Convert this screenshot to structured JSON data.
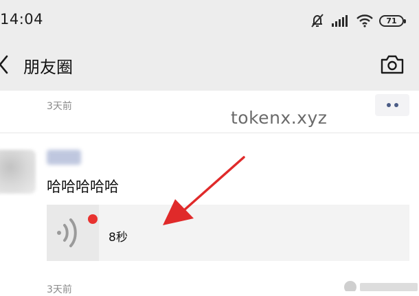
{
  "status_bar": {
    "time": "14:04",
    "battery": "71",
    "icons": [
      "mute-bell-icon",
      "signal-icon",
      "wifi-icon",
      "battery-icon"
    ]
  },
  "nav": {
    "title": "朋友圈",
    "back_icon": "chevron-left-icon",
    "camera_icon": "camera-icon"
  },
  "feed": {
    "top_post_time": "3天前",
    "watermark": "tokenx.xyz",
    "post": {
      "text": "哈哈哈哈哈",
      "voice_duration": "8秒",
      "time": "3天前"
    }
  },
  "colors": {
    "header_bg": "#ededed",
    "more_dots": "#4b5c86",
    "unread_dot": "#e8322f",
    "annotation_arrow": "#e02a2a"
  }
}
